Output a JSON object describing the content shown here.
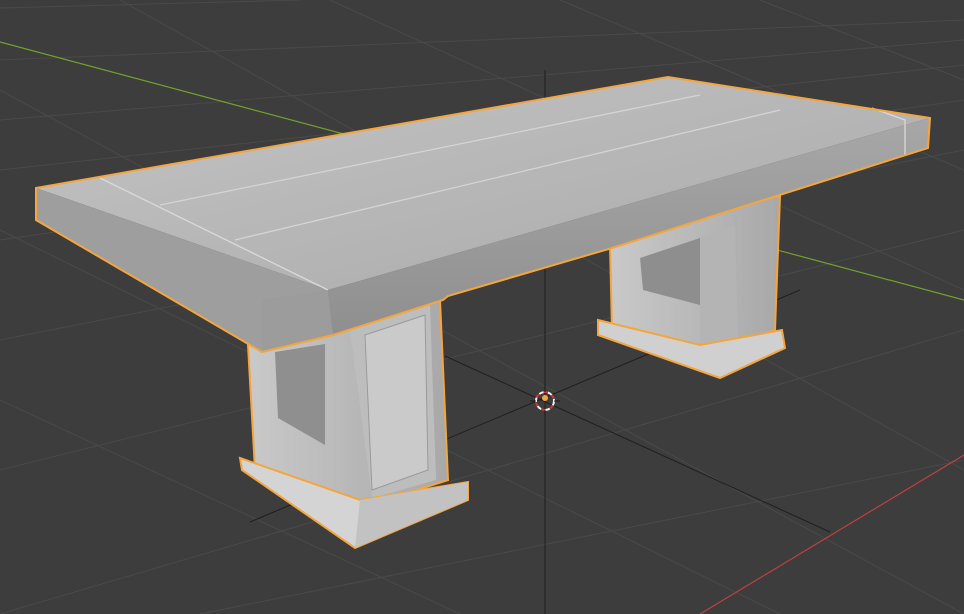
{
  "app": {
    "name": "",
    "view_label": "",
    "status_text": ""
  },
  "viewport": {
    "background": "#3d3d3d",
    "grid_color": "#4a4a4a",
    "x_axis_color": "#c0403f",
    "y_axis_color": "#74a02a"
  },
  "object": {
    "kind": "mesh",
    "description_name": "bench",
    "selected": true,
    "outline_color": "#f5a53d",
    "surface_color": "#b9b9b9"
  },
  "cursor_3d": {
    "icon": "crosshair-cursor-icon",
    "colors": [
      "#d2352b",
      "#f2f2f2"
    ]
  },
  "origin": {
    "icon": "origin-point-icon",
    "color": "#f5a53d"
  }
}
